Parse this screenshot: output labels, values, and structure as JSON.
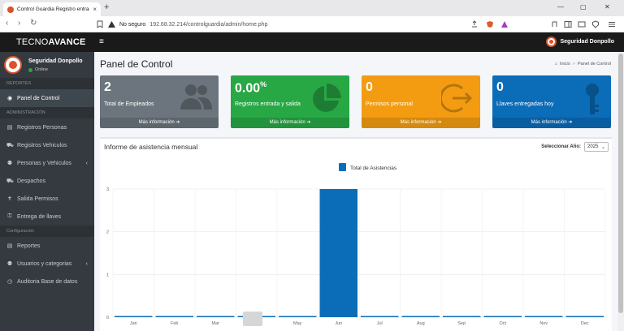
{
  "browser": {
    "tab_title": "Control Guardia Registro entrada",
    "tab_close": "×",
    "new_tab": "+",
    "not_secure": "No seguro",
    "url": "192.68.32.214/controlguardia/admin/home.php",
    "window_min": "—",
    "window_max": "▢",
    "window_close": "✕",
    "back": "‹",
    "forward": "›",
    "reload": "↻"
  },
  "app": {
    "brand_light": "TECNO",
    "brand_bold": "AVANCE",
    "hamburger": "≡",
    "user_top": "Seguridad Donpollo"
  },
  "sidebar": {
    "user_name": "Seguridad Donpollo",
    "user_status": "Online",
    "sections": {
      "reportes": "REPORTES",
      "administracion": "ADMINISTRACIÓN",
      "configuracion": "Configuración"
    },
    "items": [
      {
        "label": "Panel de Control",
        "icon": "◉"
      },
      {
        "label": "Registros Personas",
        "icon": "▤"
      },
      {
        "label": "Registros Vehiculos",
        "icon": "⛟"
      },
      {
        "label": "Personas y Vehiculos",
        "icon": "⚉",
        "caret": "‹"
      },
      {
        "label": "Despachos",
        "icon": "⛟"
      },
      {
        "label": "Salida Permisos",
        "icon": "✝"
      },
      {
        "label": "Entrega de llaves",
        "icon": "⚿"
      },
      {
        "label": "Reportes",
        "icon": "▤"
      },
      {
        "label": "Usuarios y categorias",
        "icon": "⚉",
        "caret": "‹"
      },
      {
        "label": "Auditoria Base de datos",
        "icon": "◷"
      }
    ]
  },
  "page": {
    "title": "Panel de Control",
    "breadcrumb_home": "Inicio",
    "breadcrumb_sep": ">",
    "breadcrumb_current": "Panel de Control"
  },
  "boxes": [
    {
      "value": "2",
      "suffix": "",
      "label": "Total de Empleados",
      "footer": "Más información ➔",
      "color": "#6c757d"
    },
    {
      "value": "0.00",
      "suffix": "%",
      "label": "Registros entrada y salida",
      "footer": "Más información ➔",
      "color": "#28a745"
    },
    {
      "value": "0",
      "suffix": "",
      "label": "Permisos personal",
      "footer": "Más información ➔",
      "color": "#f39c12"
    },
    {
      "value": "0",
      "suffix": "",
      "label": "Llaves entregadas hoy",
      "footer": "Más información ➔",
      "color": "#0b6cb8"
    }
  ],
  "report": {
    "title": "Informe de asistencia mensual",
    "year_label": "Seleccionar Año:",
    "year_value": "2025",
    "year_caret": "⌄"
  },
  "chart_data": {
    "type": "bar",
    "categories": [
      "Jan",
      "Feb",
      "Mar",
      "Apr",
      "May",
      "Jun",
      "Jul",
      "Aug",
      "Sep",
      "Oct",
      "Nov",
      "Dec"
    ],
    "series": [
      {
        "name": "Total de Asistencias",
        "values": [
          0,
          0,
          0,
          0,
          0,
          3,
          0,
          0,
          0,
          0,
          0,
          0
        ]
      }
    ],
    "yticks": [
      0,
      1,
      2,
      3
    ],
    "ylim": [
      0,
      3
    ],
    "grid": true,
    "legend": "top",
    "color": "#0b6cb8"
  }
}
